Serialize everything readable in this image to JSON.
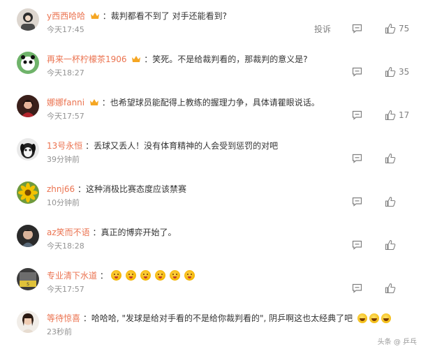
{
  "report_label": "投诉",
  "comments": [
    {
      "user": "y西西哈哈",
      "text": "裁判都看不到了 对手还能看到?",
      "time": "今天17:45",
      "likes": "75",
      "vip": true
    },
    {
      "user": "再来一杯柠檬茶1906",
      "text": "笑死。不是给裁判看的，那裁判的意义是?",
      "time": "今天18:27",
      "likes": "35",
      "vip": true
    },
    {
      "user": "娜娜fanni",
      "text": "也希望球员能配得上教练的握理力争，具体请瞿眼说话。",
      "time": "今天17:57",
      "likes": "17",
      "vip": true
    },
    {
      "user": "13号永恒",
      "text": "丢球又丢人！没有体育精神的人会受到惩罚的对吧",
      "time": "39分钟前",
      "likes": "",
      "vip": false
    },
    {
      "user": "zhnj66",
      "text": "这种消极比赛态度应该禁赛",
      "time": "10分钟前",
      "likes": "",
      "vip": false
    },
    {
      "user": "az笑而不语",
      "text": "真正的博弈开始了。",
      "time": "今天18:28",
      "likes": "",
      "vip": false
    },
    {
      "user": "专业清下水道",
      "text": "",
      "time": "今天17:57",
      "likes": "",
      "vip": false,
      "emoji_count": 6
    },
    {
      "user": "等待惊喜",
      "text": "哈哈哈, \"发球是给对手看的不是给你裁判看的\", 阴乒啊这也太经典了吧",
      "time": "23秒前",
      "likes": "",
      "vip": false,
      "laugh_count": 3
    }
  ],
  "watermark": "头条 @ 乒乓"
}
